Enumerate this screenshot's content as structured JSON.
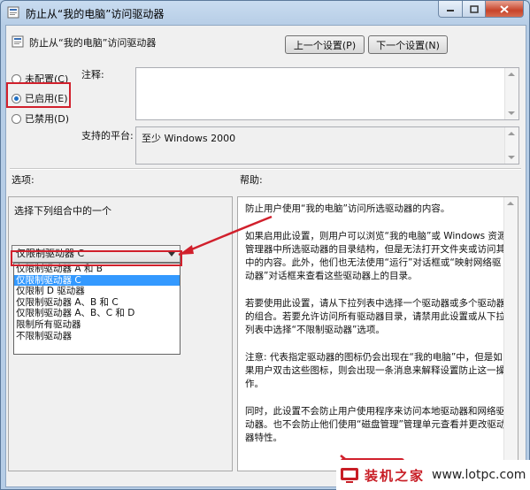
{
  "window": {
    "title": "防止从“我的电脑”访问驱动器"
  },
  "header": {
    "setting_title": "防止从“我的电脑”访问驱动器",
    "prev_label": "上一个设置(P)",
    "next_label": "下一个设置(N)"
  },
  "state": {
    "not_configured": "未配置(C)",
    "enabled": "已启用(E)",
    "disabled": "已禁用(D)",
    "selected": "enabled"
  },
  "comment": {
    "label": "注释:",
    "value": ""
  },
  "platform": {
    "label": "支持的平台:",
    "value": "至少 Windows 2000"
  },
  "options": {
    "label": "选项:",
    "prompt": "选择下列组合中的一个",
    "combo_value": "仅限制驱动器 C",
    "items": [
      "仅限制驱动器 A 和 B",
      "仅限制驱动器 C",
      "仅限制 D 驱动器",
      "仅限制驱动器 A、B 和 C",
      "仅限制驱动器 A、B、C 和 D",
      "限制所有驱动器",
      "不限制驱动器"
    ],
    "selected_index": 1
  },
  "help": {
    "label": "帮助:",
    "paragraphs": [
      "防止用户使用“我的电脑”访问所选驱动器的内容。",
      "如果启用此设置，则用户可以浏览“我的电脑”或 Windows 资源管理器中所选驱动器的目录结构，但是无法打开文件夹或访问其中的内容。此外，他们也无法使用“运行”对话框或“映射网络驱动器”对话框来查看这些驱动器上的目录。",
      "若要使用此设置，请从下拉列表中选择一个驱动器或多个驱动器的组合。若要允许访问所有驱动器目录，请禁用此设置或从下拉列表中选择“不限制驱动器”选项。",
      "注意: 代表指定驱动器的图标仍会出现在“我的电脑”中，但是如果用户双击这些图标，则会出现一条消息来解释设置防止这一操作。",
      "同时，此设置不会防止用户使用程序来访问本地驱动器和网络驱动器。也不会防止他们使用“磁盘管理”管理单元查看并更改驱动器特性。"
    ]
  },
  "watermark": {
    "brand": "装机之家",
    "url": "www.lotpc.com"
  },
  "colors": {
    "highlight": "#3399ff",
    "annotation_red": "#d1202c",
    "titlebar": "#c9dcf0"
  }
}
